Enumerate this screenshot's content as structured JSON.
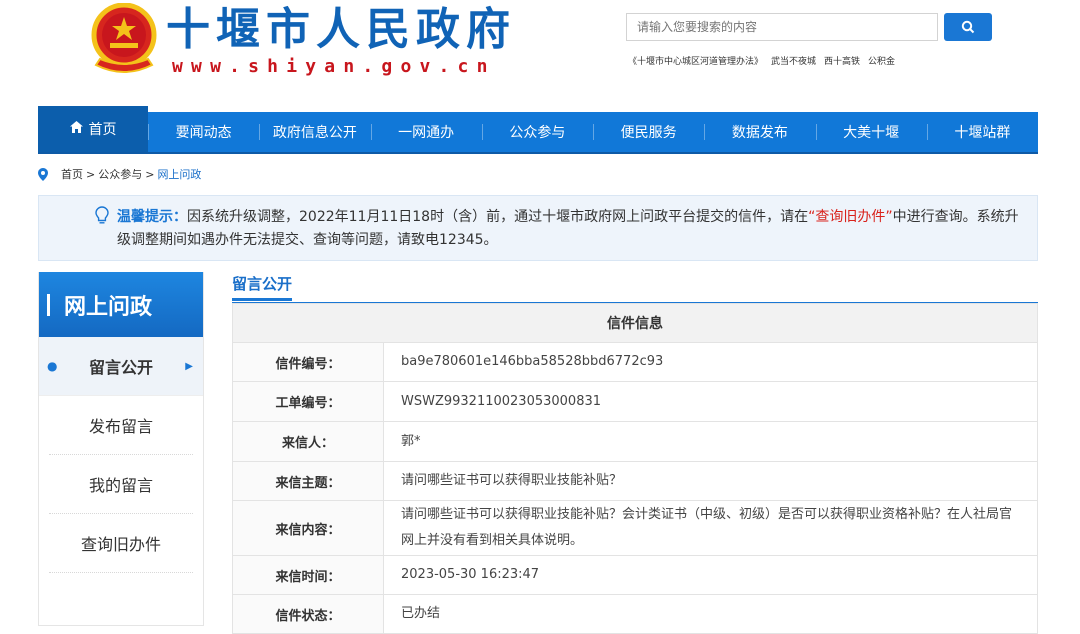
{
  "header": {
    "site_name": "十堰市人民政府",
    "site_url": "www.shiyan.gov.cn",
    "search_placeholder": "请输入您要搜索的内容",
    "hot_links": [
      "《十堰市中心城区河道管理办法》",
      "武当不夜城",
      "西十高铁",
      "公积金"
    ]
  },
  "nav": {
    "items": [
      "首页",
      "要闻动态",
      "政府信息公开",
      "一网通办",
      "公众参与",
      "便民服务",
      "数据发布",
      "大美十堰",
      "十堰站群"
    ]
  },
  "breadcrumb": {
    "items": [
      "首页",
      "公众参与",
      "网上问政"
    ],
    "separator": ">"
  },
  "notice": {
    "label": "温馨提示：",
    "text_before": "因系统升级调整，2022年11月11日18时（含）前，通过十堰市政府网上问政平台提交的信件，请在",
    "link_text": "“查询旧办件”",
    "text_after": "中进行查询。系统升级调整期间如遇办件无法提交、查询等问题，请致电12345。"
  },
  "sidebar": {
    "title": "网上问政",
    "items": [
      "留言公开",
      "发布留言",
      "我的留言",
      "查询旧办件"
    ],
    "active_index": 0
  },
  "main": {
    "section_title": "留言公开",
    "table_caption": "信件信息",
    "rows": [
      {
        "label": "信件编号：",
        "value": "ba9e780601e146bba58528bbd6772c93"
      },
      {
        "label": "工单编号：",
        "value": "WSWZ9932110023053000831"
      },
      {
        "label": "来信人：",
        "value": "郭*"
      },
      {
        "label": "来信主题：",
        "value": "请问哪些证书可以获得职业技能补贴？"
      },
      {
        "label": "来信内容：",
        "value": "请问哪些证书可以获得职业技能补贴？会计类证书（中级、初级）是否可以获得职业资格补贴？在人社局官网上并没有看到相关具体说明。"
      },
      {
        "label": "来信时间：",
        "value": "2023-05-30 16:23:47"
      },
      {
        "label": "信件状态：",
        "value": "已办结"
      }
    ]
  },
  "colors": {
    "primary": "#1178d8",
    "dark_blue": "#0c5eac",
    "brand_red": "#c8161d",
    "highlight_red": "#d9231c"
  },
  "icons": {
    "emblem": "national-emblem",
    "search": "search-icon",
    "home": "house-icon",
    "location": "location-pin-icon",
    "tip": "lightbulb-icon"
  }
}
